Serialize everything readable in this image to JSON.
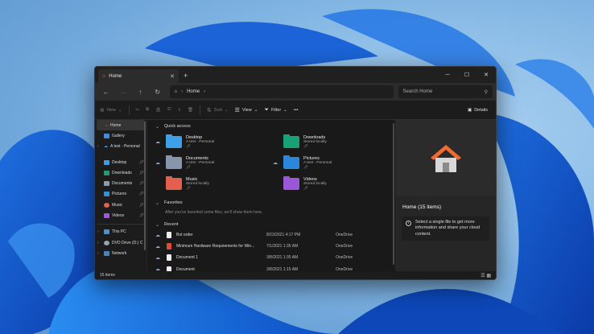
{
  "colors": {
    "accent": "#0078d4",
    "bg": "#1c1c1c",
    "home_roof": "#f26a2e"
  },
  "window": {
    "tab_title": "Home",
    "tab_icon": "home-icon"
  },
  "address": {
    "location": "Home",
    "search_placeholder": "Search Home"
  },
  "commands": {
    "new_label": "New",
    "sort_label": "Sort",
    "view_label": "View",
    "filter_label": "Filter",
    "details_label": "Details"
  },
  "sidebar": {
    "top": [
      {
        "label": "Home",
        "icon": "home-icon",
        "selected": true
      },
      {
        "label": "Gallery",
        "icon": "gallery-icon"
      },
      {
        "label": "A test - Personal",
        "icon": "cloud-icon",
        "expandable": true
      }
    ],
    "pinned": [
      {
        "label": "Desktop",
        "icon": "desktop-icon"
      },
      {
        "label": "Downloads",
        "icon": "downloads-icon"
      },
      {
        "label": "Documents",
        "icon": "documents-icon"
      },
      {
        "label": "Pictures",
        "icon": "pictures-icon"
      },
      {
        "label": "Music",
        "icon": "music-icon"
      },
      {
        "label": "Videos",
        "icon": "videos-icon"
      }
    ],
    "devices": [
      {
        "label": "This PC",
        "icon": "pc-icon"
      },
      {
        "label": "DVD Drive (D:) C",
        "icon": "dvd-icon"
      },
      {
        "label": "Network",
        "icon": "network-icon"
      }
    ]
  },
  "quick_access": {
    "title": "Quick access",
    "items": [
      {
        "name": "Desktop",
        "sub": "A test - Personal",
        "cloud": true
      },
      {
        "name": "Downloads",
        "sub": "Stored locally",
        "cloud": false
      },
      {
        "name": "Documents",
        "sub": "A test - Personal",
        "cloud": true
      },
      {
        "name": "Pictures",
        "sub": "A test - Personal",
        "cloud": true
      },
      {
        "name": "Music",
        "sub": "Stored locally",
        "cloud": false
      },
      {
        "name": "Videos",
        "sub": "Stored locally",
        "cloud": false
      }
    ]
  },
  "favorites": {
    "title": "Favorites",
    "empty": "After you've favorited some files, we'll show them here."
  },
  "recent": {
    "title": "Recent",
    "rows": [
      {
        "name": "Bot order",
        "date": "8/23/2021 4:17 PM",
        "location": "OneDrive",
        "type": "doc"
      },
      {
        "name": "Minimum Hardware Requirements for Win...",
        "date": "7/1/2021 1:35 AM",
        "location": "OneDrive",
        "type": "pdf"
      },
      {
        "name": "Document 1",
        "date": "3/8/2021 1:35 AM",
        "location": "OneDrive",
        "type": "doc"
      },
      {
        "name": "Document",
        "date": "3/8/2021 1:15 AM",
        "location": "OneDrive",
        "type": "doc"
      }
    ]
  },
  "details_pane": {
    "title": "Home (15 items)",
    "info": "Select a single file to get more information and share your cloud content."
  },
  "status": {
    "count": "15 items"
  }
}
